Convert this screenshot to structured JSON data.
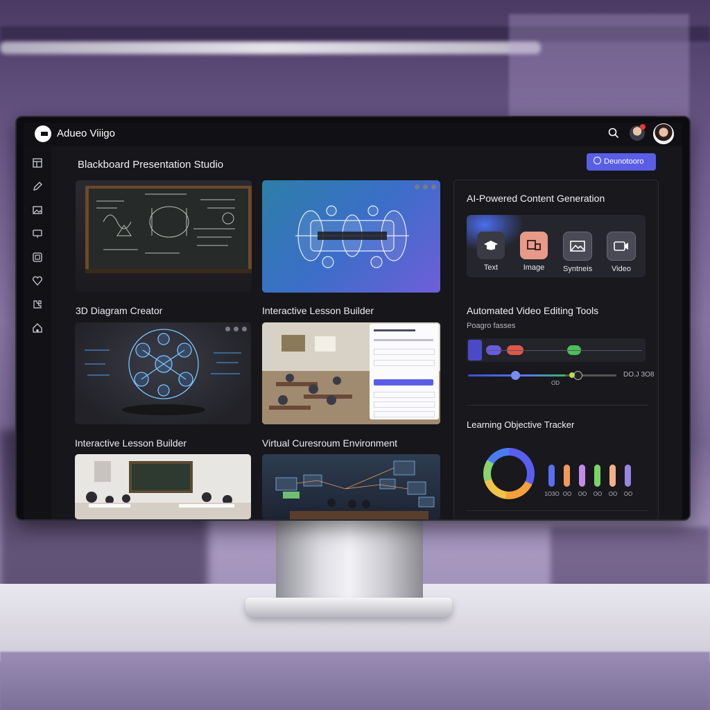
{
  "app": {
    "title": "Adueo Viiigo"
  },
  "header": {
    "search_icon": "search-icon",
    "notification_icon": "user-avatar-notification",
    "avatar": "user-avatar"
  },
  "sidebar": {
    "icons": [
      "layout-icon",
      "pencil-icon",
      "image-icon",
      "presentation-icon",
      "frame-icon",
      "heart-icon",
      "puzzle-icon",
      "home-icon"
    ]
  },
  "main": {
    "title": "Blackboard Presentation Studio",
    "action_button": "Deunotooro",
    "cards": [
      {
        "label": "3D Diagram Creator"
      },
      {
        "label": "Interactive Lesson Builder"
      },
      {
        "label": "Interactive Lesson Builder"
      },
      {
        "label": "Virtual Curesroum Environment"
      }
    ]
  },
  "panel": {
    "ai_title": "AI-Powered Content Generation",
    "ai_items": [
      {
        "label": "Text",
        "icon": "graduation-cap-icon",
        "color": "#3a3a44"
      },
      {
        "label": "Image",
        "icon": "image-frame-icon",
        "color": "#e79a88"
      },
      {
        "label": "Syntneis",
        "icon": "landscape-icon",
        "color": "#4a4a56"
      },
      {
        "label": "Video",
        "icon": "video-icon",
        "color": "#4a4a56"
      }
    ],
    "video_title": "Automated Video Editing Tools",
    "video_subtitle": "Poagro fasses",
    "timecode": "DO.J 3O8",
    "slider_label": "OD",
    "tracker_title": "Learning Objective Tracker",
    "bar_labels": [
      "1O3O",
      "OO",
      "OO",
      "OO",
      "OO",
      "OO"
    ],
    "bar_colors": [
      "#5a6ef0",
      "#f29a5c",
      "#c48ae8",
      "#7bd46a",
      "#f2b08a",
      "#9a86e0"
    ]
  },
  "colors": {
    "accent": "#5a5ee6",
    "background": "#16161b"
  }
}
